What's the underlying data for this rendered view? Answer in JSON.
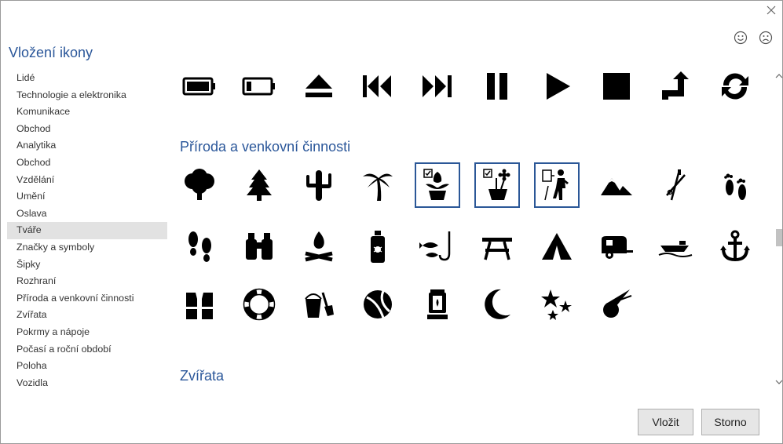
{
  "dialog": {
    "title": "Vložení ikony",
    "close_icon": "close-icon",
    "feedback_happy_icon": "smiley-icon",
    "feedback_sad_icon": "frown-icon"
  },
  "sidebar": {
    "selected_index": 9,
    "items": [
      {
        "label": "Lidé"
      },
      {
        "label": "Technologie a elektronika"
      },
      {
        "label": "Komunikace"
      },
      {
        "label": "Obchod"
      },
      {
        "label": "Analytika"
      },
      {
        "label": "Obchod"
      },
      {
        "label": "Vzdělání"
      },
      {
        "label": "Umění"
      },
      {
        "label": "Oslava"
      },
      {
        "label": "Tváře"
      },
      {
        "label": "Značky a symboly"
      },
      {
        "label": "Šipky"
      },
      {
        "label": "Rozhraní"
      },
      {
        "label": "Příroda a venkovní činnosti"
      },
      {
        "label": "Zvířata"
      },
      {
        "label": "Pokrmy a nápoje"
      },
      {
        "label": "Počasí a roční období"
      },
      {
        "label": "Poloha"
      },
      {
        "label": "Vozidla"
      }
    ]
  },
  "gallery": {
    "top_row_icons": [
      "battery-full-icon",
      "battery-low-icon",
      "eject-icon",
      "skip-back-icon",
      "skip-forward-icon",
      "pause-icon",
      "play-icon",
      "stop-icon",
      "return-arrow-icon",
      "sync-icon"
    ],
    "sections": [
      {
        "title": "Příroda a venkovní činnosti",
        "rows": [
          [
            "tree-icon",
            "pine-tree-icon",
            "cactus-icon",
            "palm-tree-icon",
            "potted-tulip-icon",
            "potted-flower-icon",
            "hiker-icon",
            "mountains-icon",
            "ski-poles-icon",
            "footprints-icon"
          ],
          [
            "shoe-prints-icon",
            "binoculars-icon",
            "campfire-icon",
            "bug-spray-icon",
            "fishing-icon",
            "picnic-table-icon",
            "tent-icon",
            "camper-trailer-icon",
            "boat-icon",
            "anchor-icon"
          ],
          [
            "life-vest-icon",
            "life-ring-icon",
            "sand-bucket-icon",
            "beach-ball-icon",
            "lantern-icon",
            "moon-icon",
            "stars-icon",
            "meteor-icon"
          ]
        ]
      },
      {
        "title": "Zvířata",
        "rows": []
      }
    ],
    "selected_icons": [
      "potted-tulip-icon",
      "potted-flower-icon",
      "hiker-icon"
    ]
  },
  "scrollbar": {
    "position": 0.5,
    "up_icon": "chevron-up-icon",
    "down_icon": "chevron-down-icon"
  },
  "buttons": {
    "insert_label": "Vložit",
    "cancel_label": "Storno"
  },
  "colors": {
    "accent": "#2b579a",
    "icon": "#000000",
    "selection_border": "#2b5797",
    "selected_item_bg": "#e2e2e2"
  }
}
